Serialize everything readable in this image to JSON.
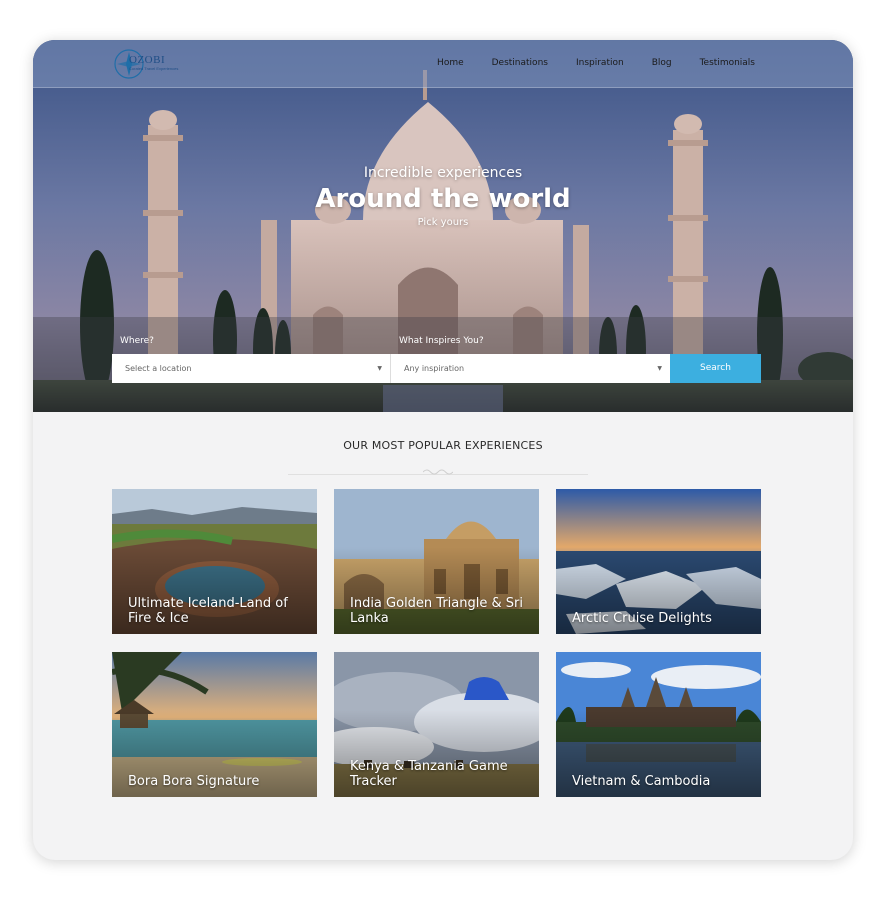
{
  "brand": {
    "logo_text": "OZOBI",
    "logo_sub": "Curated Travel Experiences"
  },
  "nav": {
    "items": [
      "Home",
      "Destinations",
      "Inspiration",
      "Blog",
      "Testimonials"
    ]
  },
  "hero": {
    "subtitle": "Incredible experiences",
    "title": "Around the world",
    "tagline": "Pick yours"
  },
  "search": {
    "where_label": "Where?",
    "where_placeholder": "Select a location",
    "inspire_label": "What Inspires You?",
    "inspire_placeholder": "Any inspiration",
    "button_label": "Search"
  },
  "section": {
    "title": "OUR MOST POPULAR EXPERIENCES"
  },
  "experiences": [
    "Ultimate Iceland-Land of Fire & Ice",
    "India Golden Triangle & Sri Lanka",
    "Arctic Cruise Delights",
    "Bora Bora Signature",
    "Kenya & Tanzania Game Tracker",
    "Vietnam & Cambodia"
  ],
  "colors": {
    "accent": "#3cafe0",
    "frame_bg": "#f3f3f4"
  }
}
